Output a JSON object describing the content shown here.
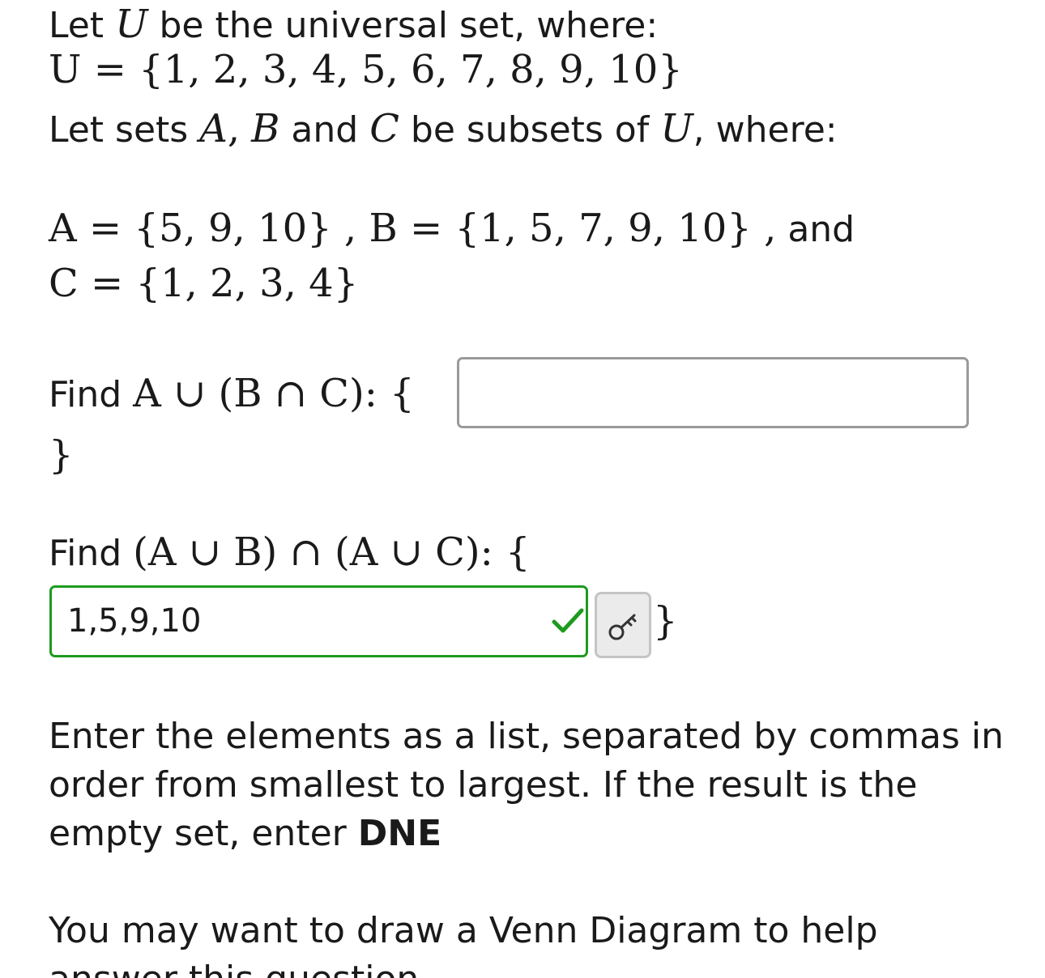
{
  "problem": {
    "line1_text": "Let ",
    "universal_var": "U",
    "line1_rest": " be the universal set, where:",
    "universal_def": "U = {1, 2, 3, 4, 5, 6, 7, 8, 9, 10}",
    "line3_prefix": "Let sets ",
    "set_a": "A",
    "comma": ",",
    "set_b": "B",
    "and_word": " and ",
    "set_c": "C",
    "line3_mid": " be subsets of ",
    "line3_end": ", where:",
    "set_a_def": "A = {5, 9, 10} , B = {1, 5, 7, 9, 10} ,",
    "and_label": " and",
    "set_c_def": "C = {1, 2, 3, 4}"
  },
  "question1": {
    "find_label": "Find ",
    "expression": "A ∪ (B ∩ C): {",
    "closing_brace": "}",
    "answer_value": ""
  },
  "question2": {
    "find_label": "Find ",
    "expression": "(A ∪ B) ∩ (A ∪ C): {",
    "answer_value": "1,5,9,10",
    "closing_brace": "}",
    "status": "correct",
    "status_color": "#1e9a1e",
    "key_button_icon": "key-icon"
  },
  "instructions": {
    "text_before_bold": "Enter the elements as a list, separated by commas in order from smallest to largest. If the result is the empty set, enter ",
    "bold_word": "DNE"
  },
  "hint": {
    "text": "You may want to draw a Venn Diagram to help answer this question."
  }
}
